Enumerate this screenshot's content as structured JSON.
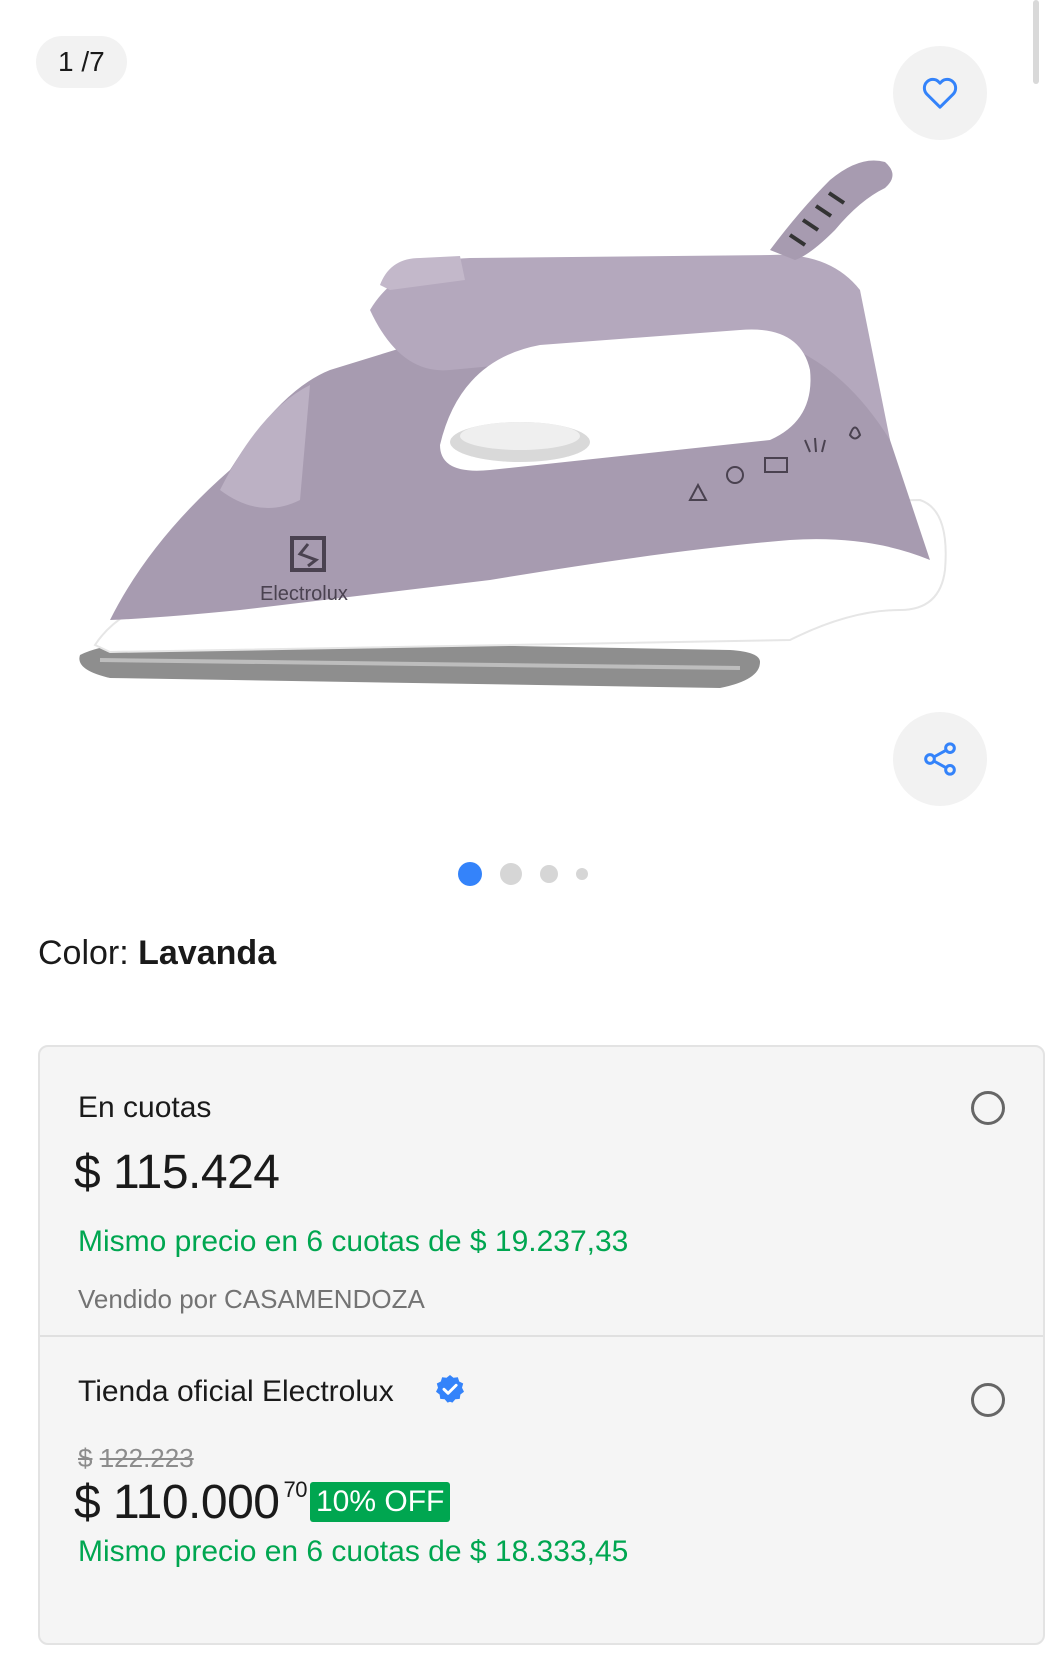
{
  "gallery": {
    "counter": "1 /7",
    "brand_on_product": "Electrolux",
    "dots": 4,
    "active_dot": 1
  },
  "color": {
    "label": "Color:",
    "value": "Lavanda"
  },
  "options": [
    {
      "title": "En cuotas",
      "price": "$ 115.424",
      "installments": "Mismo precio en 6 cuotas de $ 19.237,33",
      "seller_prefix": "Vendido por",
      "seller_name": "CASAMENDOZA",
      "seller_text": "Vendido por CASAMENDOZA"
    },
    {
      "title": "Tienda oficial Electrolux",
      "old_price_symbol": "$",
      "old_price": "122.223",
      "price": "$ 110.000",
      "price_cents": "70",
      "discount": "10% OFF",
      "installments": "Mismo precio en 6 cuotas de $ 18.333,45"
    }
  ],
  "icons": {
    "favorite": "heart-icon",
    "share": "share-icon",
    "verified": "verified-badge-icon",
    "radio": "radio-unchecked"
  },
  "colors": {
    "accent_blue": "#3483fa",
    "green": "#00a650",
    "product_lavender": "#a79bb0"
  }
}
